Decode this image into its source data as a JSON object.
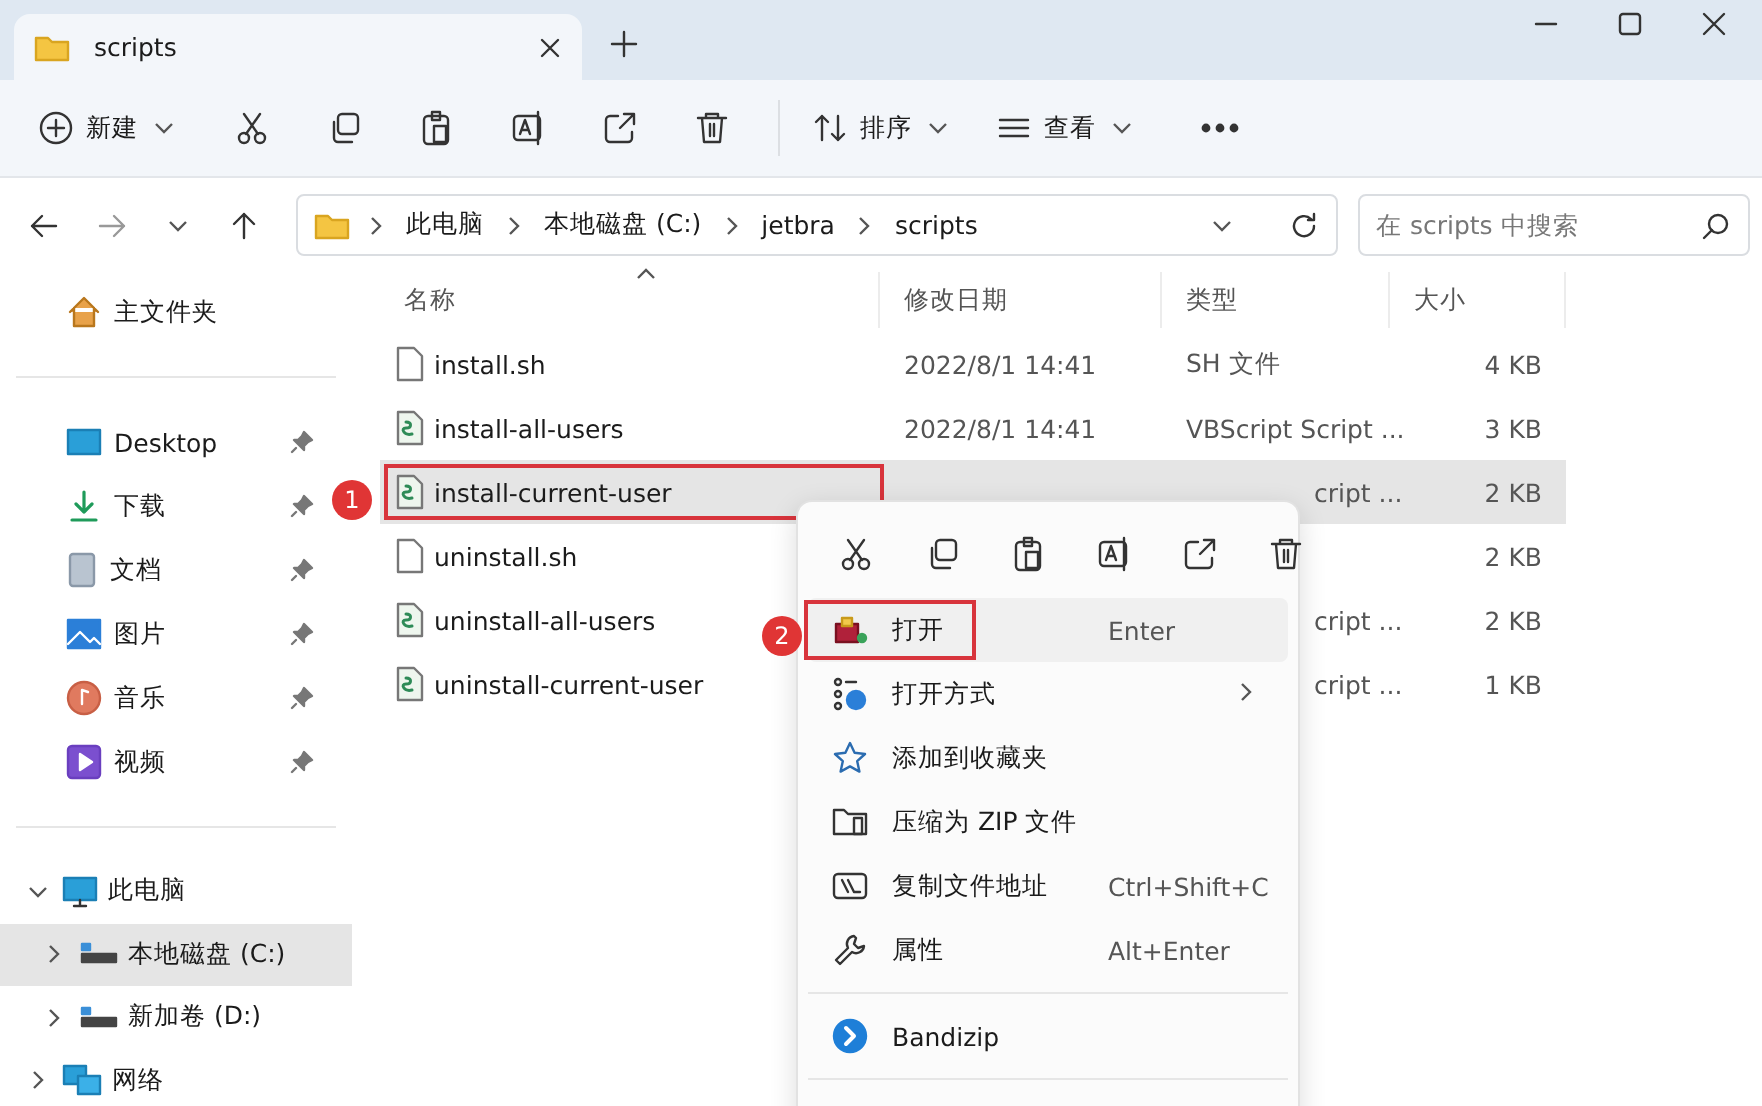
{
  "window": {
    "tab_title": "scripts"
  },
  "toolbar": {
    "new": "新建",
    "sort": "排序",
    "view": "查看"
  },
  "address": {
    "segments": [
      "此电脑",
      "本地磁盘 (C:)",
      "jetbra",
      "scripts"
    ],
    "search_placeholder": "在 scripts 中搜索"
  },
  "sidebar": {
    "home": "主文件夹",
    "quick_access": [
      {
        "label": "Desktop",
        "kind": "desktop"
      },
      {
        "label": "下载",
        "kind": "download"
      },
      {
        "label": "文档",
        "kind": "documents"
      },
      {
        "label": "图片",
        "kind": "pictures"
      },
      {
        "label": "音乐",
        "kind": "music"
      },
      {
        "label": "视频",
        "kind": "video"
      }
    ],
    "tree": [
      {
        "label": "此电脑",
        "kind": "pc",
        "expanded": true,
        "selected": false,
        "children": [
          {
            "label": "本地磁盘 (C:)",
            "kind": "drive",
            "expanded": false,
            "selected": true
          },
          {
            "label": "新加卷 (D:)",
            "kind": "drive",
            "expanded": false,
            "selected": false
          }
        ]
      },
      {
        "label": "网络",
        "kind": "network",
        "expanded": false,
        "selected": false
      }
    ]
  },
  "columns": [
    "名称",
    "修改日期",
    "类型",
    "大小"
  ],
  "files": [
    {
      "name": "install.sh",
      "kind": "text",
      "date": "2022/8/1 14:41",
      "type": "SH 文件",
      "size": "4 KB",
      "selected": false,
      "highlighted": false
    },
    {
      "name": "install-all-users",
      "kind": "script",
      "date": "2022/8/1 14:41",
      "type": "VBScript Script ...",
      "size": "3 KB",
      "selected": false,
      "highlighted": false
    },
    {
      "name": "install-current-user",
      "kind": "script",
      "type": "cript ...",
      "size": "2 KB",
      "selected": true,
      "highlighted": true
    },
    {
      "name": "uninstall.sh",
      "kind": "text",
      "size": "2 KB",
      "selected": false,
      "highlighted": false
    },
    {
      "name": "uninstall-all-users",
      "kind": "script",
      "type": "cript ...",
      "size": "2 KB",
      "selected": false,
      "highlighted": false
    },
    {
      "name": "uninstall-current-user",
      "kind": "script",
      "type": "cript ...",
      "size": "1 KB",
      "selected": false,
      "highlighted": false
    }
  ],
  "context_menu": {
    "items": [
      {
        "kind": "item",
        "label": "打开",
        "shortcut": "Enter",
        "submenu": false,
        "highlighted": true
      },
      {
        "kind": "item",
        "label": "打开方式",
        "submenu": true,
        "highlighted": false
      },
      {
        "kind": "item",
        "label": "添加到收藏夹",
        "submenu": false,
        "highlighted": false
      },
      {
        "kind": "item",
        "label": "压缩为 ZIP 文件",
        "submenu": false,
        "highlighted": false
      },
      {
        "kind": "item",
        "label": "复制文件地址",
        "shortcut": "Ctrl+Shift+C",
        "submenu": false,
        "highlighted": false
      },
      {
        "kind": "item",
        "label": "属性",
        "shortcut": "Alt+Enter",
        "submenu": false,
        "highlighted": false
      },
      {
        "kind": "separator"
      },
      {
        "kind": "item",
        "label": "Bandizip",
        "submenu": false,
        "highlighted": false
      },
      {
        "kind": "separator"
      },
      {
        "kind": "clipped"
      }
    ]
  },
  "annotations": [
    {
      "label": "1"
    },
    {
      "label": "2"
    }
  ]
}
